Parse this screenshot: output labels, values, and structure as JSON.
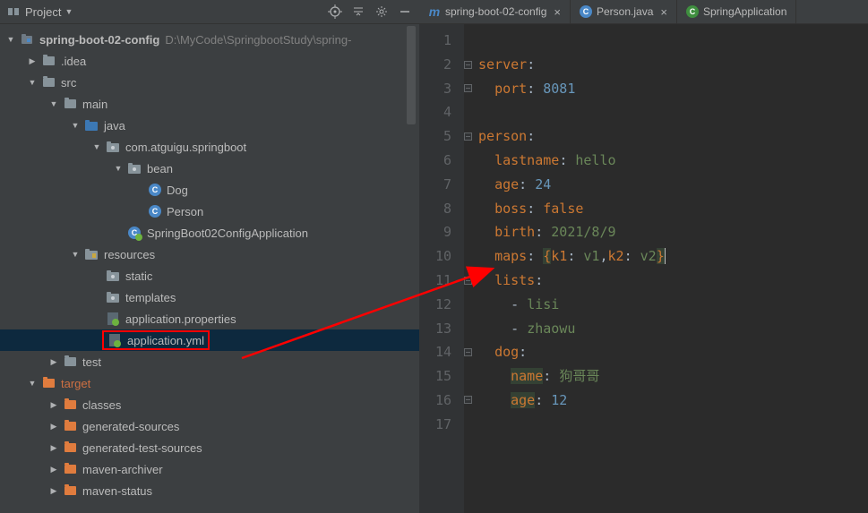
{
  "header": {
    "title": "Project"
  },
  "tabs": [
    {
      "label": "spring-boot-02-config",
      "icon": "maven",
      "color": "#4a88c7"
    },
    {
      "label": "Person.java",
      "icon": "class",
      "color": "#4a88c7"
    },
    {
      "label": "SpringApplication",
      "icon": "class-interface",
      "color": "#3f8e3f"
    }
  ],
  "tree": {
    "root": {
      "label": "spring-boot-02-config",
      "path": "D:\\MyCode\\SpringbootStudy\\spring-"
    },
    "items": {
      "idea": ".idea",
      "src": "src",
      "main": "main",
      "java": "java",
      "pkg": "com.atguigu.springboot",
      "bean": "bean",
      "dog": "Dog",
      "person": "Person",
      "app": "SpringBoot02ConfigApplication",
      "resources": "resources",
      "static": "static",
      "templates": "templates",
      "appprops": "application.properties",
      "appyml": "application.yml",
      "test": "test",
      "target": "target",
      "classes": "classes",
      "gensources": "generated-sources",
      "gentestsources": "generated-test-sources",
      "mavenarchiver": "maven-archiver",
      "mavenstatus": "maven-status"
    }
  },
  "code": {
    "lines": [
      "",
      "server:",
      "  port: 8081",
      "",
      "person:",
      "  lastname: hello",
      "  age: 24",
      "  boss: false",
      "  birth: 2021/8/9",
      "  maps: {k1: v1,k2: v2}",
      "  lists:",
      "    - lisi",
      "    - zhaowu",
      "  dog:",
      "    name: 狗哥哥",
      "    age: 12",
      ""
    ]
  },
  "chart_data": null
}
